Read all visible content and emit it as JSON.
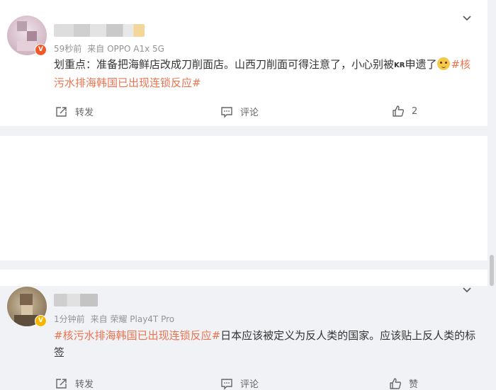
{
  "posts": [
    {
      "badge": "V",
      "time": "59秒前",
      "source": "来自 OPPO A1x 5G",
      "content": {
        "lead": "划重点：准备把海鲜店改成刀削面店。山西刀削面可得注意了，小心别被",
        "kr": "KR",
        "mid": "申遗了",
        "emoji_icon": "doge-emoji-icon",
        "tag": "#核污水排海韩国已出现连锁反应#",
        "tail": ""
      },
      "actions": {
        "forward": "转发",
        "comment": "评论",
        "like": "2"
      }
    },
    {
      "badge": "V",
      "time": "1分钟前",
      "source": "来自 荣耀 Play4T Pro",
      "content": {
        "tag": "#核污水排海韩国已出现连锁反应#",
        "tail": "日本应该被定义为反人类的国家。应该贴上反人类的标签"
      },
      "actions": {
        "forward": "转发",
        "comment": "评论",
        "like": "赞"
      }
    }
  ],
  "colors": {
    "accent": "#eb7350",
    "meta": "#939393",
    "background": "#f1f2f5"
  }
}
